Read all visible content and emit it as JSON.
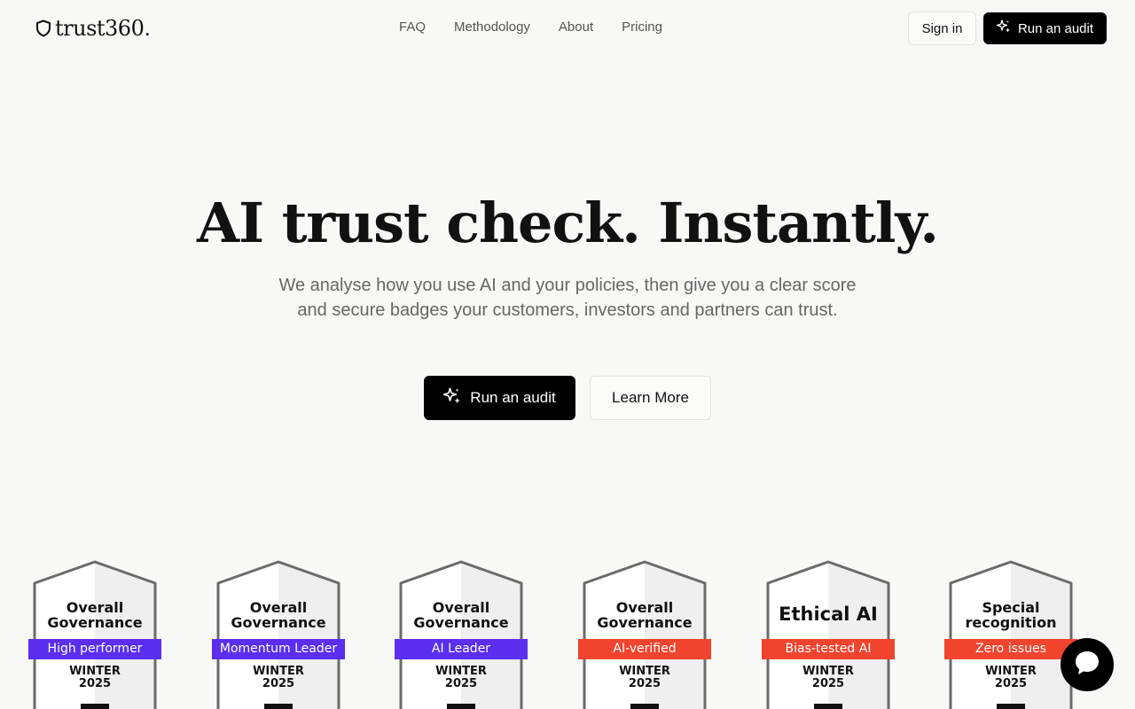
{
  "brand": {
    "name": "trust360."
  },
  "nav": {
    "items": [
      {
        "label": "FAQ"
      },
      {
        "label": "Methodology"
      },
      {
        "label": "About"
      },
      {
        "label": "Pricing"
      }
    ]
  },
  "header": {
    "signin_label": "Sign in",
    "audit_label": "Run an audit"
  },
  "hero": {
    "title": "AI trust check. Instantly.",
    "subtitle": "We analyse how you use AI and your policies, then give you a clear score and secure badges your customers, investors and partners can trust.",
    "primary_cta": "Run an audit",
    "secondary_cta": "Learn More"
  },
  "badges": [
    {
      "title": "Overall Governance",
      "ribbon": "High performer",
      "ribbon_color": "#5b2ef0",
      "season": "WINTER",
      "year": "2025"
    },
    {
      "title": "Overall Governance",
      "ribbon": "Momentum Leader",
      "ribbon_color": "#5b2ef0",
      "season": "WINTER",
      "year": "2025"
    },
    {
      "title": "Overall Governance",
      "ribbon": "AI Leader",
      "ribbon_color": "#5b2ef0",
      "season": "WINTER",
      "year": "2025"
    },
    {
      "title": "Overall Governance",
      "ribbon": "AI-verified",
      "ribbon_color": "#f0442e",
      "season": "WINTER",
      "year": "2025"
    },
    {
      "title": "Ethical AI",
      "ribbon": "Bias-tested AI",
      "ribbon_color": "#f0442e",
      "season": "WINTER",
      "year": "2025"
    },
    {
      "title": "Special recognition",
      "ribbon": "Zero issues",
      "ribbon_color": "#f0442e",
      "season": "WINTER",
      "year": "2025"
    }
  ],
  "icons": {
    "logo": "shield-icon",
    "audit": "sparkle-icon",
    "chat": "chat-bubble-icon"
  }
}
